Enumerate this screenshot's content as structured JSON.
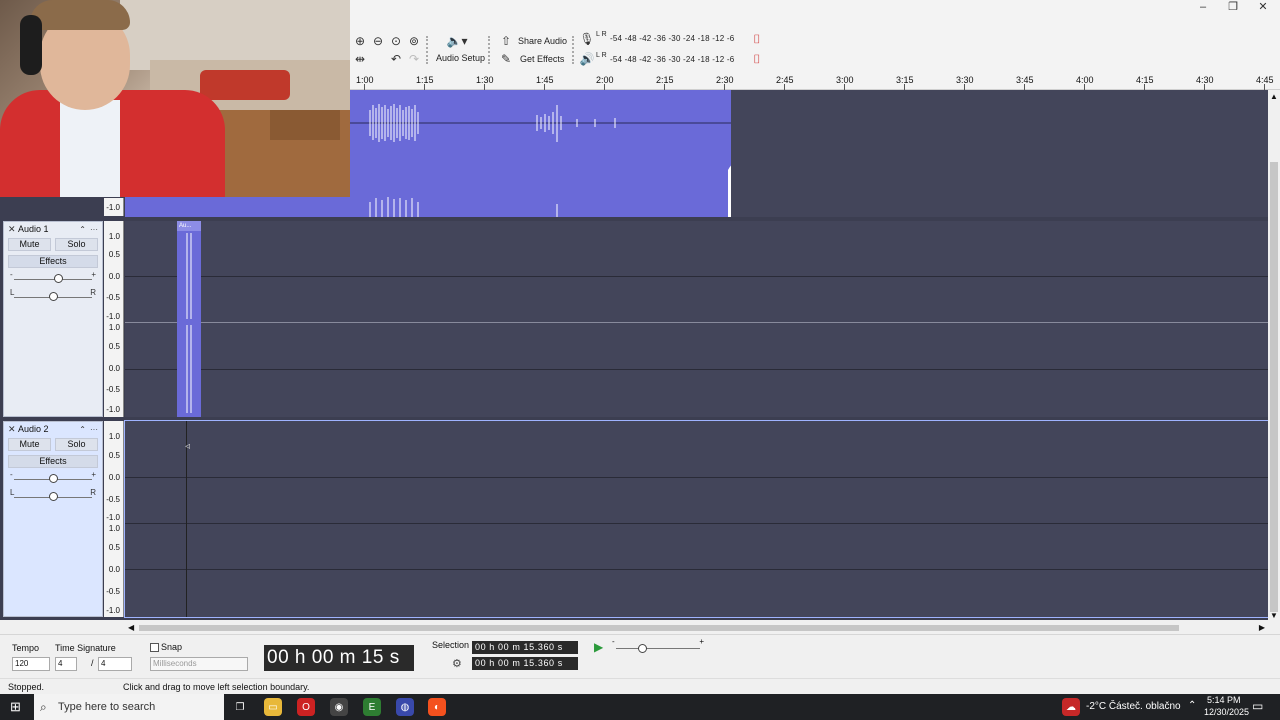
{
  "window": {
    "minimize_label": "–",
    "restore_label": "❐",
    "close_label": "✕"
  },
  "toolbar": {
    "audio_setup_label": "Audio Setup",
    "share_audio_label": "Share Audio",
    "get_effects_label": "Get Effects",
    "record_meter_channels": "L R",
    "play_meter_channels": "L R",
    "meter_ticks": [
      "-54",
      "-48",
      "-42",
      "-36",
      "-30",
      "-24",
      "-18",
      "-12",
      "-6"
    ]
  },
  "timeline": {
    "ticks": [
      "1:00",
      "1:15",
      "1:30",
      "1:45",
      "2:00",
      "2:15",
      "2:30",
      "2:45",
      "3:00",
      "3:15",
      "3:30",
      "3:45",
      "4:00",
      "4:15",
      "4:30",
      "4:45"
    ]
  },
  "tracks": [
    {
      "name": "Audio 1",
      "mute_label": "Mute",
      "solo_label": "Solo",
      "effects_label": "Effects",
      "gain_minus": "-",
      "gain_plus": "+",
      "pan_left": "L",
      "pan_right": "R",
      "clip_label": "Au...",
      "ruler": [
        "1.0",
        "0.5",
        "0.0",
        "-0.5",
        "-1.0",
        "1.0",
        "0.5",
        "0.0",
        "-0.5",
        "-1.0"
      ]
    },
    {
      "name": "Audio 2",
      "mute_label": "Mute",
      "solo_label": "Solo",
      "effects_label": "Effects",
      "gain_minus": "-",
      "gain_plus": "+",
      "pan_left": "L",
      "pan_right": "R",
      "ruler": [
        "1.0",
        "0.5",
        "0.0",
        "-0.5",
        "-1.0",
        "1.0",
        "0.5",
        "0.0",
        "-0.5",
        "-1.0"
      ]
    }
  ],
  "top_track_ruler_bottom": "-1.0",
  "bottom": {
    "tempo_label": "Tempo",
    "tempo_value": "120",
    "time_signature_label": "Time Signature",
    "ts_numerator": "4",
    "ts_slash": "/",
    "ts_denominator": "4",
    "snap_label": "Snap",
    "snap_unit": "Milliseconds",
    "time_display": "00 h 00 m 15 s",
    "selection_label": "Selection",
    "selection_start": "00 h 00 m 15.360 s",
    "selection_end": "00 h 00 m 15.360 s",
    "play_speed_minus": "-",
    "play_speed_plus": "+"
  },
  "status": {
    "state": "Stopped.",
    "hint": "Click and drag to move left selection boundary."
  },
  "taskbar": {
    "search_placeholder": "Type here to search",
    "weather": "-2°C  Částeč. oblačno",
    "time": "5:14 PM",
    "date": "12/30/2025"
  },
  "colors": {
    "track_bg": "#43455a",
    "waveform": "#6a6ad8",
    "header_bg": "#e8ecf4"
  }
}
